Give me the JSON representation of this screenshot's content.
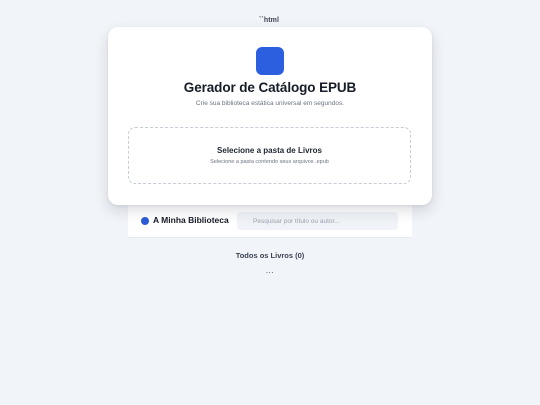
{
  "top_fragment": "``html",
  "header": {
    "title": "Gerador de Catálogo EPUB",
    "subtitle": "Crie sua biblioteca estática universal em segundos."
  },
  "dropzone": {
    "title": "Selecione a pasta de Livros",
    "hint": "Selecione a pasta contendo seus arquivos .epub"
  },
  "library": {
    "title": "A Minha Biblioteca",
    "search_placeholder": "Pesquisar por título ou autor..."
  },
  "books": {
    "heading": "Todos os Livros (0)",
    "loading": "..."
  },
  "colors": {
    "accent": "#2b5fe0",
    "background": "#f1f4f8"
  },
  "icons": {
    "app_logo": "app-logo-icon",
    "library_dot": "dot-icon"
  }
}
